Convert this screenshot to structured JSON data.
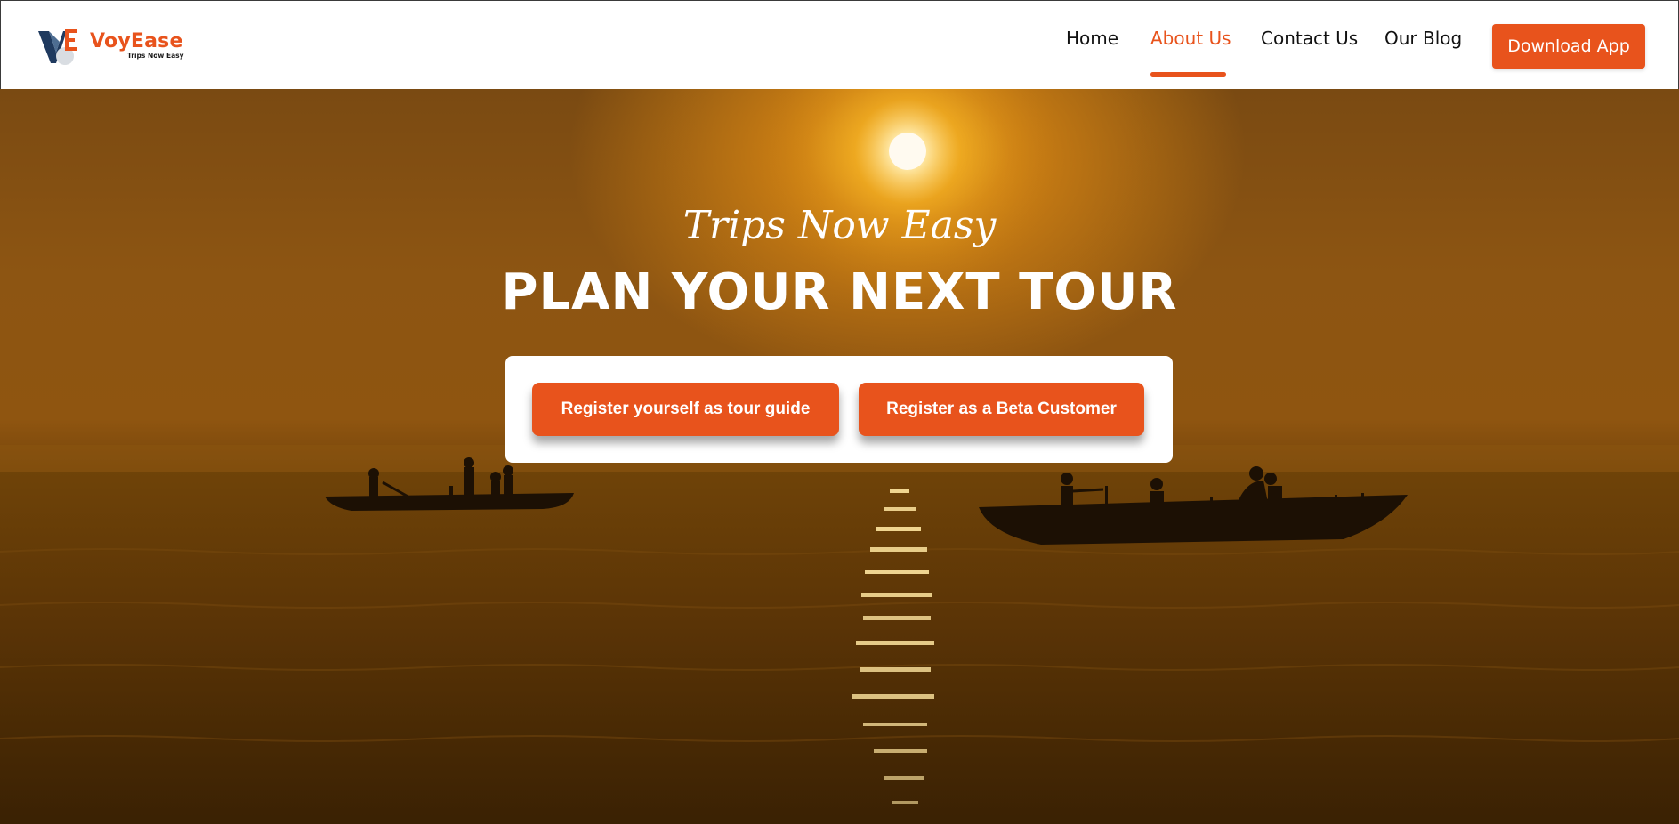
{
  "brand": {
    "name": "VoyEase",
    "tagline": "Trips Now Easy",
    "mark_letters": "VE",
    "accent_color": "#e8531c",
    "mark_color": "#1f3a5f"
  },
  "nav": {
    "items": [
      {
        "label": "Home",
        "active": false
      },
      {
        "label": "About Us",
        "active": true
      },
      {
        "label": "Contact Us",
        "active": false
      },
      {
        "label": "Our Blog",
        "active": false
      }
    ],
    "download_label": "Download App"
  },
  "hero": {
    "tagline": "Trips Now Easy",
    "headline": "PLAN YOUR NEXT TOUR",
    "background": "sunset-river-boats",
    "cta": {
      "guide_label": "Register yourself as tour guide",
      "beta_label": "Register as a Beta Customer"
    }
  }
}
